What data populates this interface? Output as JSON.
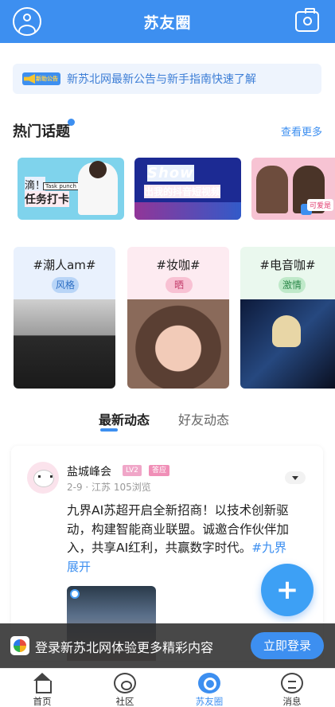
{
  "header": {
    "title": "苏友圈",
    "avatar_icon": "user-circle-icon",
    "camera_icon": "camera-icon",
    "bg_color": "#3d8ff0"
  },
  "notice": {
    "tag_label": "新助公告",
    "text": "新苏北网最新公告与新手指南快速了解"
  },
  "hot_topics": {
    "heading": "热门话题",
    "more_label": "查看更多",
    "banners": [
      {
        "line1": "滴！",
        "line2": "任务打卡",
        "tag": "Task punch"
      },
      {
        "line1": "Show",
        "line2": "出我的抖音短视频"
      },
      {
        "label": "可爱是"
      }
    ],
    "topics": [
      {
        "name": "#潮人am#",
        "pill": "风格"
      },
      {
        "name": "#妆咖#",
        "pill": "晒"
      },
      {
        "name": "#电音咖#",
        "pill": "激情"
      }
    ]
  },
  "feed_tabs": {
    "active": "最新动态",
    "other": "好友动态"
  },
  "post": {
    "username": "盐城峰会",
    "level": "LV2",
    "role": "答应",
    "meta": "2-9 · 江苏  105浏览",
    "content": "九界AI苏超开启全新招商！以技术创新驱动，构建智能商业联盟。诚邀合作伙伴加入，共享AI红利，共赢数字时代。",
    "hashtag": "#九界",
    "expand_label": "展开"
  },
  "fab_label": "+",
  "login_bar": {
    "message": "登录新苏北网体验更多精彩内容",
    "button_label": "立即登录"
  },
  "bottom_nav": [
    {
      "label": "首页",
      "icon": "home-icon"
    },
    {
      "label": "社区",
      "icon": "community-icon"
    },
    {
      "label": "苏友圈",
      "icon": "circle-icon",
      "active": true
    },
    {
      "label": "消息",
      "icon": "message-icon"
    }
  ]
}
